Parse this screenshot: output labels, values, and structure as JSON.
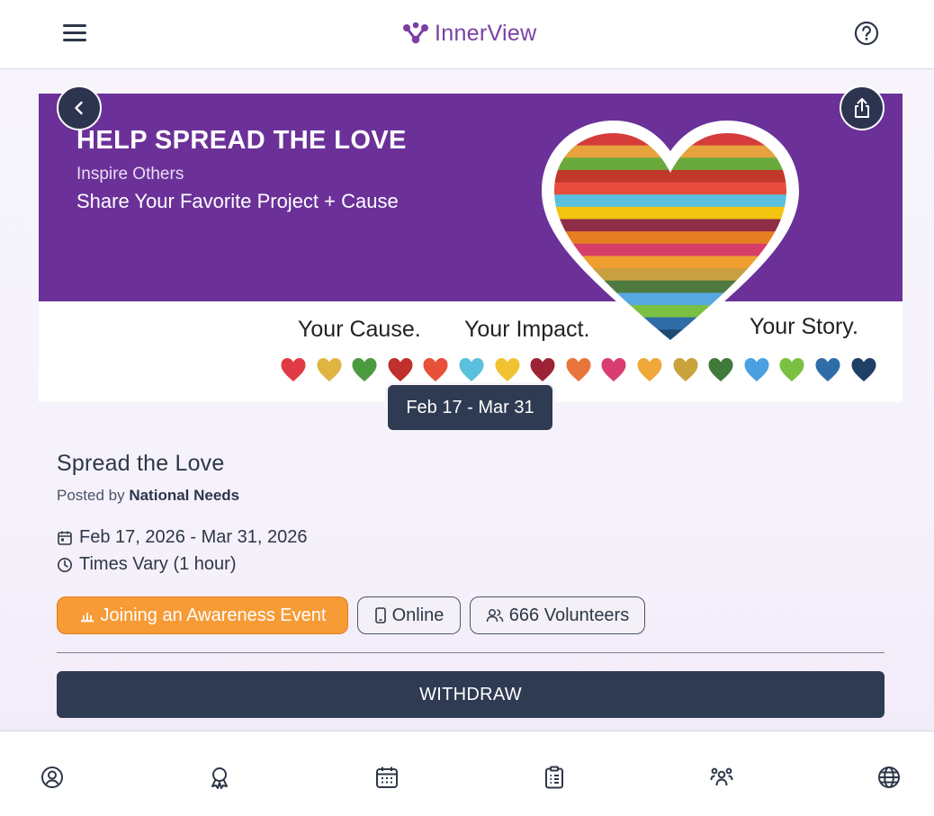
{
  "header": {
    "logo_text": "InnerView",
    "menu_icon": "hamburger-menu-icon",
    "help_icon": "help-circle-icon"
  },
  "banner": {
    "headline": "HELP SPREAD THE LOVE",
    "subline1": "Inspire Others",
    "subline2": "Share Your Favorite Project + Cause",
    "tag1": "Your Cause.",
    "tag2": "Your Impact.",
    "tag3": "Your Story.",
    "purple": "#6b3199",
    "heart_stripes": [
      "#d63c3c",
      "#e6a23c",
      "#6aaa3c",
      "#c0392b",
      "#e74c3c",
      "#5bc0de",
      "#f1c40f",
      "#8e2d46",
      "#e67e22",
      "#d63e6a",
      "#f0a030",
      "#c8a040",
      "#4e7a40",
      "#56a8e0",
      "#7ac043",
      "#2f6da8",
      "#1f4a70"
    ],
    "small_hearts": [
      "#e03a45",
      "#e0b440",
      "#4c9a3e",
      "#c0302c",
      "#e8503a",
      "#5bc0de",
      "#f1c232",
      "#9b2335",
      "#e8763a",
      "#d93d72",
      "#f0a83a",
      "#c9a23a",
      "#3f7a3a",
      "#4aa0e0",
      "#7ac043",
      "#2f6da8",
      "#1f3f66"
    ]
  },
  "actions": {
    "back_icon": "chevron-left-icon",
    "share_icon": "share-icon"
  },
  "date_chip": "Feb 17 - Mar 31",
  "event": {
    "title": "Spread the Love",
    "posted_prefix": "Posted by ",
    "posted_by": "National Needs",
    "date_range": "Feb 17, 2026 - Mar 31, 2026",
    "times": "Times Vary (1 hour)"
  },
  "tags": {
    "category": "Joining an Awareness Event",
    "mode": "Online",
    "volunteers": "666 Volunteers"
  },
  "buttons": {
    "withdraw": "WITHDRAW"
  },
  "colors": {
    "accent_orange": "#f69b36",
    "dark": "#2f3b52",
    "brand_purple": "#7a3fa3"
  },
  "tabbar": [
    "profile-icon",
    "award-icon",
    "calendar-icon",
    "clipboard-icon",
    "community-icon",
    "globe-icon"
  ]
}
